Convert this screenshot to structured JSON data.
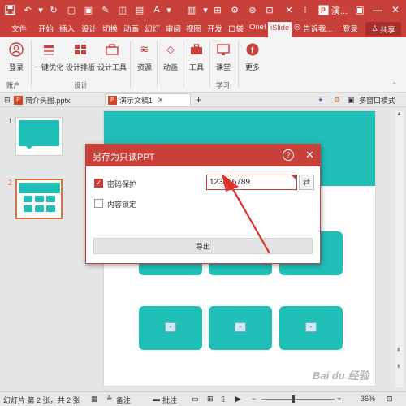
{
  "titlebar": {
    "quick_access": [
      "save-icon",
      "undo-icon",
      "redo-icon",
      "print-icon",
      "preview-icon",
      "format-icon",
      "font-icon",
      "clipboard-icon",
      "dropdown-icon"
    ],
    "title": "演..."
  },
  "tabs": {
    "file": "文件",
    "items": [
      "开始",
      "插入",
      "设计",
      "切换",
      "动画",
      "幻灯",
      "审阅",
      "视图",
      "开发",
      "口袋",
      "OneI"
    ],
    "active": "iSlide",
    "tell_me": "告诉我...",
    "login": "登录",
    "share": "共享"
  },
  "ribbon": {
    "buttons": {
      "login": "登录",
      "optimize": "一键优化",
      "design_layout": "设计排版",
      "design_tools": "设计工具",
      "resources": "资源",
      "animation": "动画",
      "tools": "工具",
      "classroom": "课堂",
      "more": "更多"
    },
    "groups": {
      "account": "账户",
      "design": "设计",
      "learn": "学习"
    }
  },
  "doctabs": {
    "tab1": "简介头图.pptx",
    "tab2": "演示文稿1",
    "add": "+",
    "multi_window": "多窗口模式"
  },
  "thumbnails": {
    "num1": "1",
    "num2": "2"
  },
  "status": {
    "slide_info": "幻灯片 第 2 张，共 2 张",
    "notes": "备注",
    "comments": "批注",
    "zoom": "36%"
  },
  "dialog": {
    "title": "另存为只读PPT",
    "help": "?",
    "close": "✕",
    "password_protect": "密码保护",
    "password_value": "123456789",
    "content_lock": "内容锁定",
    "export": "导出",
    "password_checked": true,
    "lock_checked": false
  },
  "watermark": "Bai du 经验",
  "colors": {
    "accent": "#c8403a",
    "teal": "#1fbfb8"
  }
}
